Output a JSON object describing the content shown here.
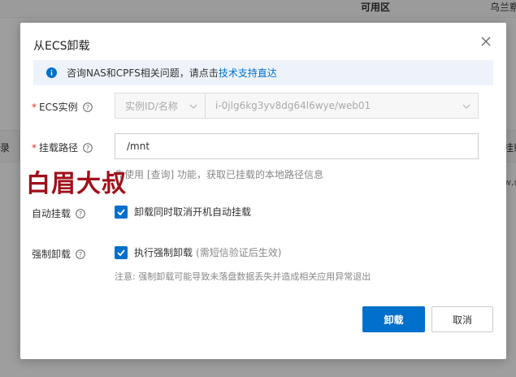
{
  "background": {
    "col_available_zone": "可用区",
    "col_zone_value": "乌兰察",
    "left_fragment": "录",
    "right_fragment": "挂载",
    "right_sub_fragment": "w,r"
  },
  "dialog": {
    "title": "从ECS卸载",
    "notice_text": "咨询NAS和CPFS相关问题，请点击",
    "notice_link": "技术支持直达",
    "ecs_label": "ECS实例",
    "ecs_select_type": "实例ID/名称",
    "ecs_select_value": "i-0jlg6kg3yv8dg64l6wye/web01",
    "path_label": "挂载路径",
    "path_value": "/mnt",
    "path_hint": "先使用 [查询] 功能，获取已挂载的本地路径信息",
    "auto_label": "自动挂载",
    "auto_check_text": "卸载同时取消开机自动挂载",
    "force_label": "强制卸载",
    "force_check_text": "执行强制卸载",
    "force_check_note": "(需短信验证后生效)",
    "warning": "注意: 强制卸载可能导致未落盘数据丢失并造成相关应用异常退出",
    "confirm_button": "卸载",
    "cancel_button": "取消"
  },
  "watermark": "白眉大叔",
  "colors": {
    "primary": "#0070cc",
    "required": "#d93026",
    "notice_bg": "#eef3fb"
  }
}
